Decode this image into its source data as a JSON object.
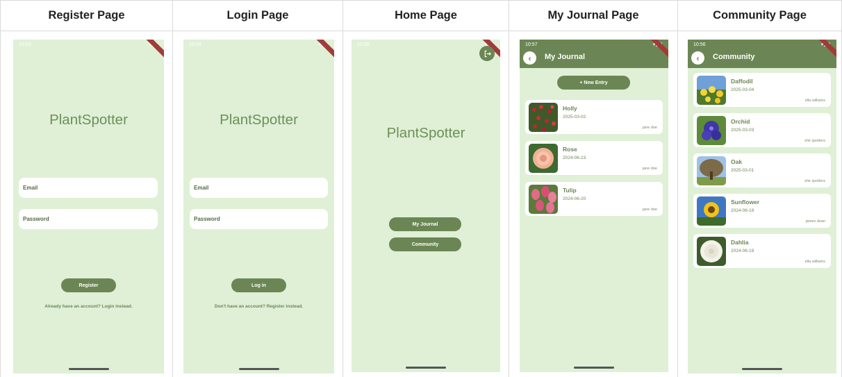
{
  "headers": [
    "Register Page",
    "Login Page",
    "Home Page",
    "My Journal Page",
    "Community Page"
  ],
  "status": {
    "register": "10:53",
    "login": "10:54",
    "home": "10:55",
    "journal": "10:57",
    "community": "10:56"
  },
  "app_name": "PlantSpotter",
  "register": {
    "email_label": "Email",
    "password_label": "Password",
    "button": "Register",
    "footer": "Already have an account? Login instead."
  },
  "login": {
    "email_label": "Email",
    "password_label": "Password",
    "button": "Log in",
    "footer": "Don't have an account? Register instead."
  },
  "home": {
    "journal_button": "My Journal",
    "community_button": "Community"
  },
  "journal": {
    "title": "My Journal",
    "new_entry": "+ New Entry",
    "entries": [
      {
        "name": "Holly",
        "date": "2025-03-02",
        "user": "jane doe",
        "thumb": "holly"
      },
      {
        "name": "Rose",
        "date": "2024-06-23",
        "user": "jane doe",
        "thumb": "rose"
      },
      {
        "name": "Tulip",
        "date": "2024-06-20",
        "user": "jane doe",
        "thumb": "tulip"
      }
    ]
  },
  "community": {
    "title": "Community",
    "entries": [
      {
        "name": "Daffodil",
        "date": "2025-03-04",
        "user": "ella williams",
        "thumb": "daffodil"
      },
      {
        "name": "Orchid",
        "date": "2025-03-03",
        "user": "shir spotters",
        "thumb": "orchid"
      },
      {
        "name": "Oak",
        "date": "2025-03-01",
        "user": "shir spotters",
        "thumb": "oak"
      },
      {
        "name": "Sunflower",
        "date": "2024-06-19",
        "user": "james dean",
        "thumb": "sunflower"
      },
      {
        "name": "Dahlia",
        "date": "2024-06-19",
        "user": "ella williams",
        "thumb": "dahlia"
      }
    ]
  },
  "colors": {
    "background": "#dff0d6",
    "primary": "#6b8654",
    "brand_text": "#6f8f58"
  }
}
